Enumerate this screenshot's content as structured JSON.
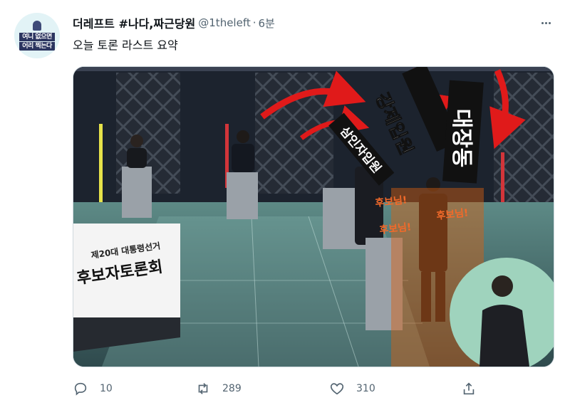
{
  "profile": {
    "display_name": "더레프트 #나다,짜근당원",
    "handle": "@1theleft",
    "time": "6분",
    "avatar_line1": "여니 없으면",
    "avatar_line2": "어리 찍는다"
  },
  "tweet": {
    "text": "오늘 토론 라스트 요약"
  },
  "media": {
    "stage_sign_line1": "제20대 대통령선거",
    "stage_sign_line2": "후보자토론회",
    "caption_1": "강제입원",
    "caption_2": "삼인자입원",
    "caption_3": "대장동",
    "callout_1": "후보님!",
    "callout_2": "후보님!",
    "callout_3": "후보님!",
    "colors": {
      "arrow": "#e01a1a",
      "callout": "#f26a2a",
      "overlay": "#d9600f"
    }
  },
  "actions": {
    "reply_count": "10",
    "retweet_count": "289",
    "like_count": "310",
    "icons": [
      "reply-icon",
      "retweet-icon",
      "like-icon",
      "share-icon"
    ]
  }
}
